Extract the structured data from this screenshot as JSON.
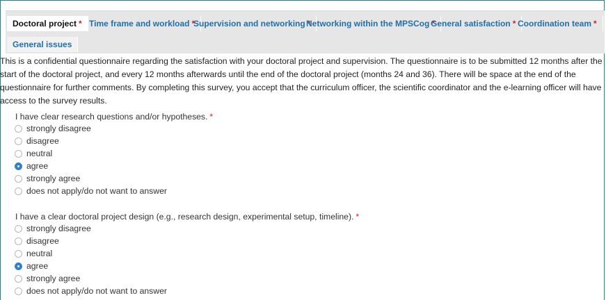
{
  "tabs": [
    {
      "label": "Doctoral project",
      "required": "*",
      "active": true
    },
    {
      "label": "Time frame and workload",
      "required": "*",
      "active": false
    },
    {
      "label": "Supervision and networking",
      "required": "*",
      "active": false
    },
    {
      "label": "Networking within the MPSCog",
      "required": "*",
      "active": false
    },
    {
      "label": "General satisfaction",
      "required": "*",
      "active": false
    },
    {
      "label": "Coordination team",
      "required": "*",
      "active": false
    },
    {
      "label": "General issues",
      "required": "",
      "active": false
    }
  ],
  "intro": "This is a confidential questionnaire regarding the satisfaction with your doctoral project and supervision. The questionnaire is to be submitted 12 months after the start of the doctoral project, and every 12 months afterwards until the end of the doctoral project (months 24 and 36). There will be space at the end of the questionnaire for further comments. By completing this survey, you accept that the curriculum officer, the scientific coordinator and the e-learning officer will have access to the survey results.",
  "questions": [
    {
      "text": "I have clear research questions and/or hypotheses.",
      "required": "*",
      "options": [
        "strongly disagree",
        "disagree",
        "neutral",
        "agree",
        "strongly agree",
        "does not apply/do not want to answer"
      ],
      "selected": "agree"
    },
    {
      "text": "I have a clear doctoral project design (e.g., research design, experimental setup, timeline).",
      "required": "*",
      "options": [
        "strongly disagree",
        "disagree",
        "neutral",
        "agree",
        "strongly agree",
        "does not apply/do not want to answer"
      ],
      "selected": "agree"
    }
  ],
  "colors": {
    "accent": "#1f6fa8",
    "required": "#d0202a",
    "radio_checked": "#2f80d1",
    "frame_border": "#2a7a8a"
  }
}
